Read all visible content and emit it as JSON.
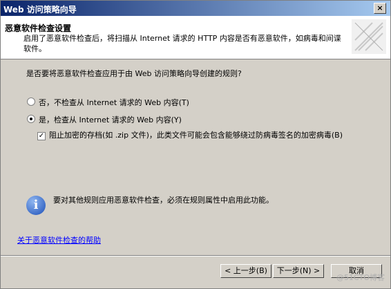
{
  "window": {
    "title": "Web 访问策略向导",
    "close_label": "×"
  },
  "header": {
    "heading": "恶意软件检查设置",
    "description": "启用了恶意软件检查后，将扫描从 Internet 请求的 HTTP 内容是否有恶意软件，如病毒和间谍软件。"
  },
  "main": {
    "question": "是否要将恶意软件检查应用于由 Web 访问策略向导创建的规则?",
    "option_no": "否，不检查从 Internet 请求的 Web 内容(T)",
    "option_yes": "是，检查从 Internet 请求的 Web 内容(Y)",
    "block_encrypted_label": "阻止加密的存档(如 .zip 文件)，此类文件可能会包含能够绕过防病毒签名的加密病毒(B)",
    "block_encrypted_checked": true,
    "selected_option": "yes",
    "info_text": "要对其他规则应用恶意软件检查，必须在规则属性中启用此功能。",
    "help_link": "关于恶意软件检查的帮助"
  },
  "buttons": {
    "back": "< 上一步(B)",
    "next": "下一步(N) >",
    "cancel": "取消"
  },
  "watermark": "@51CTO博客"
}
